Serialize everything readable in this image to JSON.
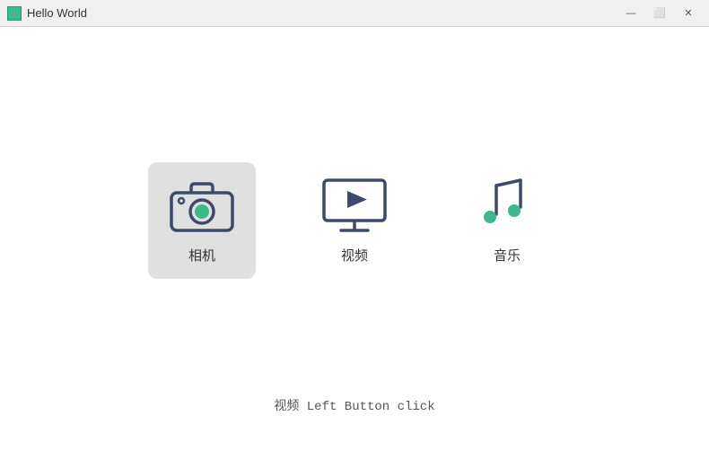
{
  "titlebar": {
    "title": "Hello World",
    "icon_color": "#3db88a",
    "minimize_label": "—",
    "maximize_label": "⬜",
    "close_label": "✕"
  },
  "icons": [
    {
      "id": "camera",
      "label": "相机",
      "active": true
    },
    {
      "id": "video",
      "label": "视频",
      "active": false
    },
    {
      "id": "music",
      "label": "音乐",
      "active": false
    }
  ],
  "status": {
    "text": "视频 Left Button click"
  }
}
